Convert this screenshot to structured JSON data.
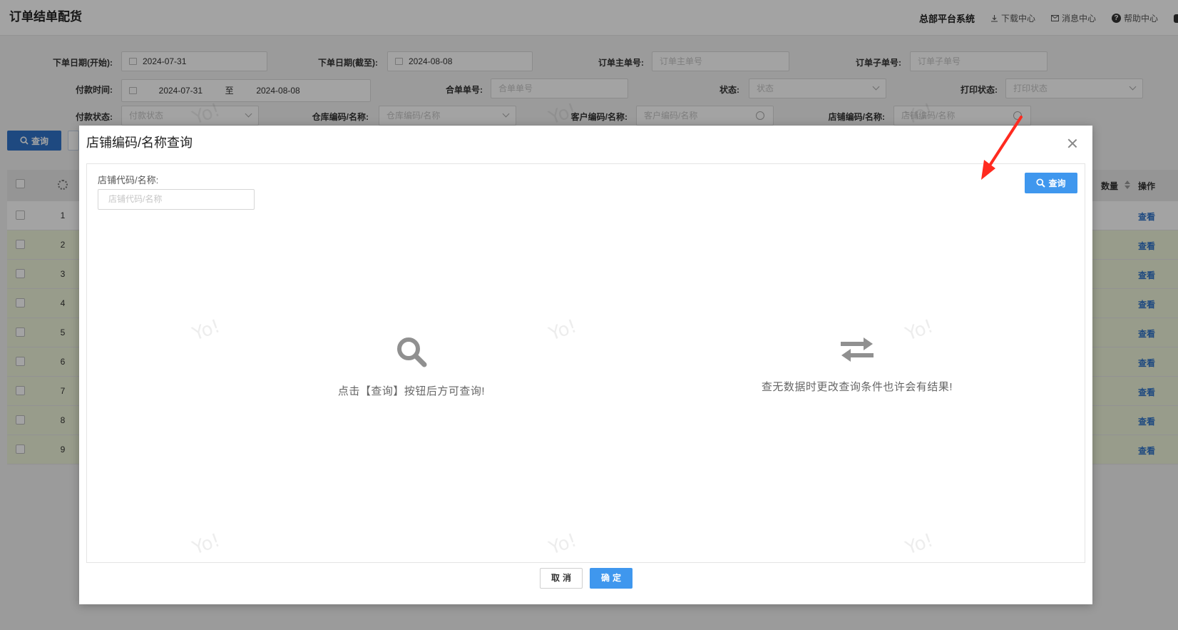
{
  "header": {
    "title": "订单结单配货",
    "system_name": "总部平台系统",
    "download_center": "下载中心",
    "message_center": "消息中心",
    "help_center": "帮助中心"
  },
  "filters": {
    "order_date_start": {
      "label": "下单日期(开始):",
      "value": "2024-07-31"
    },
    "order_date_end": {
      "label": "下单日期(截至):",
      "value": "2024-08-08"
    },
    "main_order_no": {
      "label": "订单主单号:",
      "placeholder": "订单主单号"
    },
    "sub_order_no": {
      "label": "订单子单号:",
      "placeholder": "订单子单号"
    },
    "pay_time": {
      "label": "付款时间:",
      "from": "2024-07-31",
      "sep": "至",
      "to": "2024-08-08"
    },
    "merge_no": {
      "label": "合单单号:",
      "placeholder": "合单单号"
    },
    "status": {
      "label": "状态:",
      "placeholder": "状态"
    },
    "print_status": {
      "label": "打印状态:",
      "placeholder": "打印状态"
    },
    "pay_status": {
      "label": "付款状态:",
      "placeholder": "付款状态"
    },
    "warehouse": {
      "label": "仓库编码/名称:",
      "placeholder": "仓库编码/名称"
    },
    "customer": {
      "label": "客户编码/名称:",
      "placeholder": "客户编码/名称"
    },
    "store": {
      "label": "店铺编码/名称:",
      "placeholder": "店铺编码/名称"
    }
  },
  "toolbar": {
    "query_label": "查询"
  },
  "table": {
    "qty_header": "数量",
    "op_header": "操作",
    "view_label": "查看",
    "rows": [
      "1",
      "2",
      "3",
      "4",
      "5",
      "6",
      "7",
      "8",
      "9"
    ]
  },
  "modal": {
    "title": "店铺编码/名称查询",
    "field_label": "店铺代码/名称:",
    "field_placeholder": "店铺代码/名称",
    "search_label": "查询",
    "hint_left": "点击【查询】按钮后方可查询!",
    "hint_right": "查无数据时更改查询条件也许会有结果!",
    "cancel_label": "取消",
    "ok_label": "确定"
  },
  "colors": {
    "primary": "#3f97ee",
    "primary_dark": "#2f73c9",
    "row_highlight": "#eef5d9",
    "arrow": "#ff2a1f"
  }
}
